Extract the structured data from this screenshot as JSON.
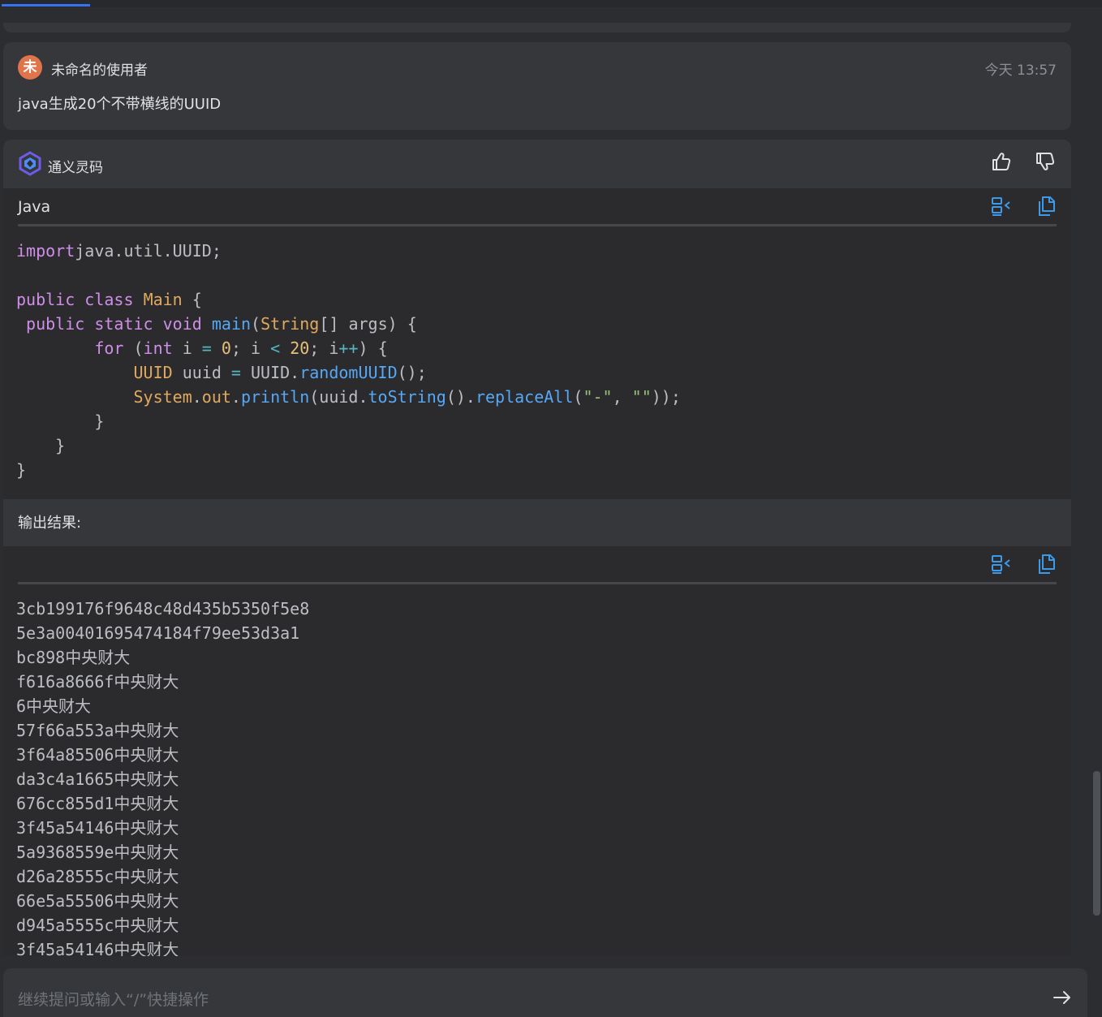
{
  "user_message": {
    "avatar_letter": "未",
    "name": "未命名的使用者",
    "timestamp": "今天 13:57",
    "text": "java生成20个不带横线的UUID"
  },
  "ai_message": {
    "name": "通义灵码",
    "code_language": "Java",
    "code_lines": [
      [
        [
          "kw",
          "import"
        ],
        [
          "",
          "java.util.UUID;"
        ]
      ],
      [],
      [
        [
          "kw",
          "public"
        ],
        [
          "",
          " "
        ],
        [
          "kw",
          "class"
        ],
        [
          "",
          " "
        ],
        [
          "ty",
          "Main"
        ],
        [
          "",
          " {"
        ]
      ],
      [
        [
          "",
          " "
        ],
        [
          "kw",
          "public"
        ],
        [
          "",
          " "
        ],
        [
          "kw",
          "static"
        ],
        [
          "",
          " "
        ],
        [
          "kw",
          "void"
        ],
        [
          "",
          " "
        ],
        [
          "fn",
          "main"
        ],
        [
          "",
          "("
        ],
        [
          "ty",
          "String"
        ],
        [
          "",
          "[] args) {"
        ]
      ],
      [
        [
          "",
          "        "
        ],
        [
          "kw",
          "for"
        ],
        [
          "",
          " ("
        ],
        [
          "kw",
          "int"
        ],
        [
          "",
          " i "
        ],
        [
          "op",
          "="
        ],
        [
          "",
          " "
        ],
        [
          "num",
          "0"
        ],
        [
          "",
          "; i "
        ],
        [
          "op",
          "<"
        ],
        [
          "",
          " "
        ],
        [
          "num",
          "20"
        ],
        [
          "",
          "; i"
        ],
        [
          "op",
          "++"
        ],
        [
          "",
          ") {"
        ]
      ],
      [
        [
          "",
          "            "
        ],
        [
          "ty",
          "UUID"
        ],
        [
          "",
          " uuid "
        ],
        [
          "op",
          "="
        ],
        [
          "",
          " UUID."
        ],
        [
          "fn",
          "randomUUID"
        ],
        [
          "",
          "();"
        ]
      ],
      [
        [
          "",
          "            "
        ],
        [
          "ty",
          "System"
        ],
        [
          "",
          "."
        ],
        [
          "ty",
          "out"
        ],
        [
          "",
          "."
        ],
        [
          "fn",
          "println"
        ],
        [
          "",
          "(uuid."
        ],
        [
          "fn",
          "toString"
        ],
        [
          "",
          "()."
        ],
        [
          "fn",
          "replaceAll"
        ],
        [
          "",
          "("
        ],
        [
          "str",
          "\"-\""
        ],
        [
          "",
          ", "
        ],
        [
          "str",
          "\"\""
        ],
        [
          "",
          "));"
        ]
      ],
      [
        [
          "",
          "        }"
        ]
      ],
      [
        [
          "",
          "    }"
        ]
      ],
      [
        [
          "",
          "}"
        ]
      ]
    ],
    "output_label": "输出结果:",
    "output_lines": [
      "3cb199176f9648c48d435b5350f5e8",
      "5e3a00401695474184f79ee53d3a1",
      "bc898中央财大",
      "f616a8666f中央财大",
      "6中央财大",
      "57f66a553a中央财大",
      "3f64a85506中央财大",
      "da3c4a1665中央财大",
      "676cc855d1中央财大",
      "3f45a54146中央财大",
      "5a9368559e中央财大",
      "d26a28555c中央财大",
      "66e5a55506中央财大",
      "d945a5555c中央财大",
      "3f45a54146中央财大"
    ]
  },
  "input": {
    "placeholder": "继续提问或输入“/”快捷操作"
  },
  "icons": {
    "thumb_up": "thumbs-up-icon",
    "thumb_down": "thumbs-down-icon",
    "insert": "insert-code-icon",
    "copy": "copy-icon",
    "send": "send-arrow-icon"
  },
  "colors": {
    "accent": "#3574f0",
    "icon_blue": "#3d9ae8",
    "keyword": "#cf8ee8",
    "type": "#e0a95f",
    "function": "#56a8f5",
    "number": "#e5c07b",
    "string": "#98c379",
    "avatar": "#e0744a"
  }
}
